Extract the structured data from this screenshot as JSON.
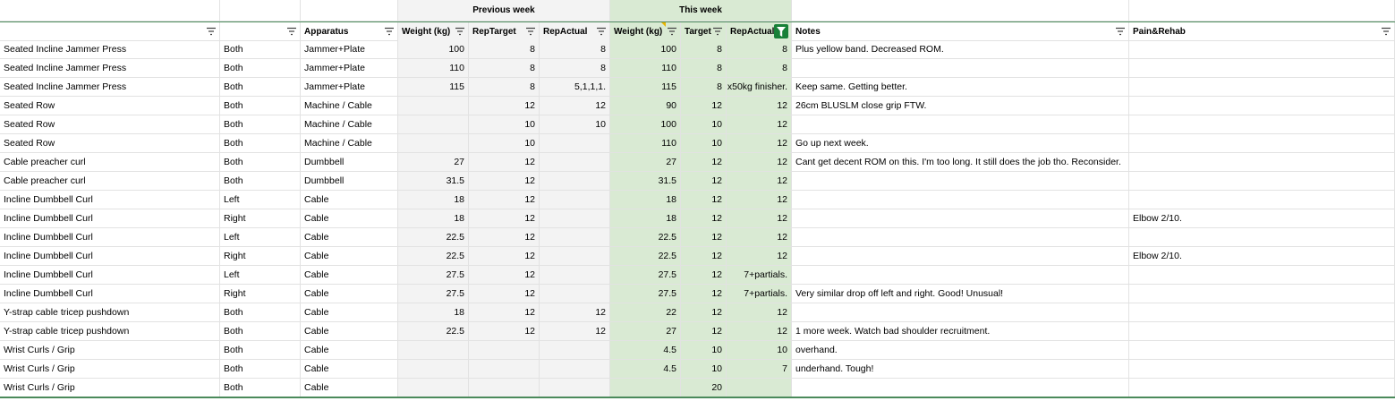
{
  "group_headers": {
    "previous_week": "Previous week",
    "this_week": "This week"
  },
  "columns": [
    "",
    "",
    "Apparatus",
    "Weight (kg)",
    "RepTarget",
    "RepActual",
    "Weight (kg)",
    "Target",
    "RepActual",
    "Notes",
    "Pain&Rehab"
  ],
  "rows": [
    [
      "Seated Incline Jammer Press",
      "Both",
      "Jammer+Plate",
      "100",
      "8",
      "8",
      "100",
      "8",
      "8",
      "Plus yellow band. Decreased ROM.",
      ""
    ],
    [
      "Seated Incline Jammer Press",
      "Both",
      "Jammer+Plate",
      "110",
      "8",
      "8",
      "110",
      "8",
      "8",
      "",
      ""
    ],
    [
      "Seated Incline Jammer Press",
      "Both",
      "Jammer+Plate",
      "115",
      "8",
      "5,1,1,1.",
      "115",
      "8",
      "x50kg finisher.",
      "Keep same. Getting better.",
      ""
    ],
    [
      "Seated Row",
      "Both",
      "Machine / Cable",
      "",
      "12",
      "12",
      "90",
      "12",
      "12",
      "26cm BLUSLM close grip FTW.",
      ""
    ],
    [
      "Seated Row",
      "Both",
      "Machine / Cable",
      "",
      "10",
      "10",
      "100",
      "10",
      "12",
      "",
      ""
    ],
    [
      "Seated Row",
      "Both",
      "Machine / Cable",
      "",
      "10",
      "",
      "110",
      "10",
      "12",
      "Go up next week.",
      ""
    ],
    [
      "Cable preacher curl",
      "Both",
      "Dumbbell",
      "27",
      "12",
      "",
      "27",
      "12",
      "12",
      "Cant get decent ROM on this. I'm too long. It still does the job tho. Reconsider.",
      ""
    ],
    [
      "Cable preacher curl",
      "Both",
      "Dumbbell",
      "31.5",
      "12",
      "",
      "31.5",
      "12",
      "12",
      "",
      ""
    ],
    [
      "Incline Dumbbell Curl",
      "Left",
      "Cable",
      "18",
      "12",
      "",
      "18",
      "12",
      "12",
      "",
      ""
    ],
    [
      "Incline Dumbbell Curl",
      "Right",
      "Cable",
      "18",
      "12",
      "",
      "18",
      "12",
      "12",
      "",
      "Elbow 2/10."
    ],
    [
      "Incline Dumbbell Curl",
      "Left",
      "Cable",
      "22.5",
      "12",
      "",
      "22.5",
      "12",
      "12",
      "",
      ""
    ],
    [
      "Incline Dumbbell Curl",
      "Right",
      "Cable",
      "22.5",
      "12",
      "",
      "22.5",
      "12",
      "12",
      "",
      "Elbow 2/10."
    ],
    [
      "Incline Dumbbell Curl",
      "Left",
      "Cable",
      "27.5",
      "12",
      "",
      "27.5",
      "12",
      "7+partials.",
      "",
      ""
    ],
    [
      "Incline Dumbbell Curl",
      "Right",
      "Cable",
      "27.5",
      "12",
      "",
      "27.5",
      "12",
      "7+partials.",
      "Very similar drop off left and right. Good! Unusual!",
      ""
    ],
    [
      "Y-strap cable tricep pushdown",
      "Both",
      "Cable",
      "18",
      "12",
      "12",
      "22",
      "12",
      "12",
      "",
      ""
    ],
    [
      "Y-strap cable tricep pushdown",
      "Both",
      "Cable",
      "22.5",
      "12",
      "12",
      "27",
      "12",
      "12",
      "1 more week. Watch bad shoulder recruitment.",
      ""
    ],
    [
      "Wrist Curls / Grip",
      "Both",
      "Cable",
      "",
      "",
      "",
      "4.5",
      "10",
      "10",
      "overhand.",
      ""
    ],
    [
      "Wrist Curls / Grip",
      "Both",
      "Cable",
      "",
      "",
      "",
      "4.5",
      "10",
      "7",
      "underhand. Tough!",
      ""
    ],
    [
      "Wrist Curls / Grip",
      "Both",
      "Cable",
      "",
      "",
      "",
      "",
      "20",
      "",
      "",
      ""
    ]
  ],
  "colors": {
    "header_border": "#4b8a5b",
    "previous_week_fill": "#f3f3f3",
    "this_week_fill": "#d9ead3",
    "active_filter": "#188038"
  }
}
